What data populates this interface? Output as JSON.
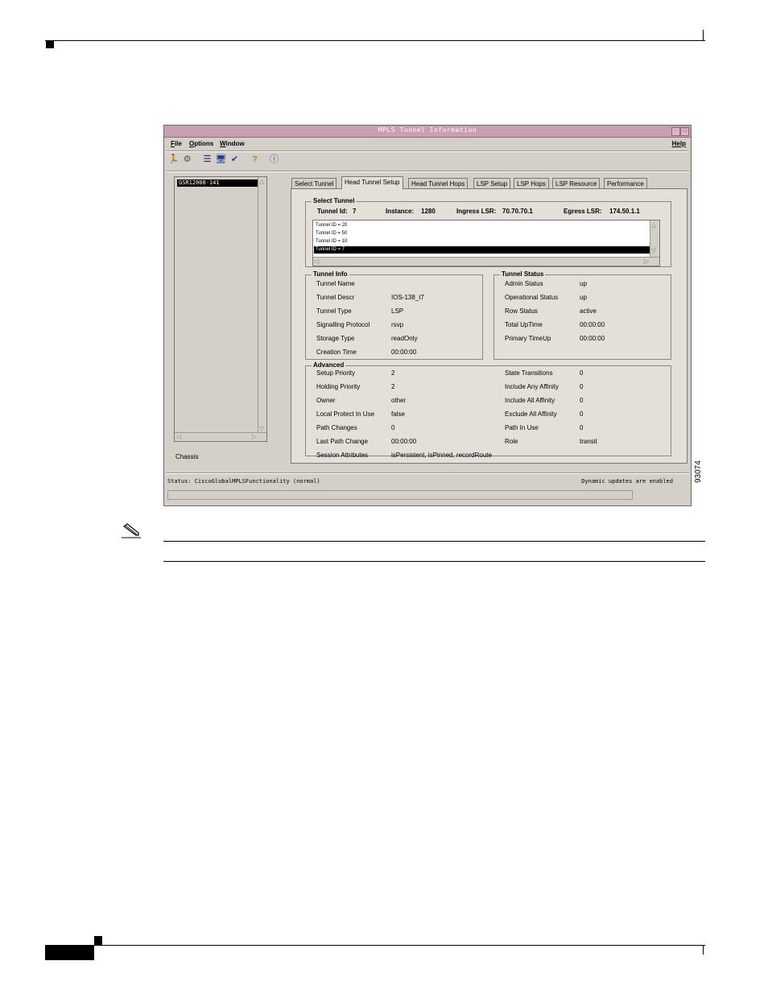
{
  "window": {
    "title": "MPLS Tunnel Information",
    "menus": [
      {
        "label": "File",
        "u": "F",
        "rest": "ile"
      },
      {
        "label": "Options",
        "u": "O",
        "rest": "ptions"
      },
      {
        "label": "Window",
        "u": "W",
        "rest": "indow"
      }
    ],
    "help_menu": "Help",
    "toolbar_icons": [
      "run-icon",
      "deploy-icon",
      "list-icon",
      "monitor-icon",
      "check-icon",
      "help-icon",
      "info-icon"
    ]
  },
  "tree": {
    "selected_node": "GSR12008-141",
    "chassis_label": "Chassis"
  },
  "tabs": [
    {
      "label": "Select Tunnel",
      "active": false
    },
    {
      "label": "Head Tunnel Setup",
      "active": true
    },
    {
      "label": "Head Tunnel Hops",
      "active": false
    },
    {
      "label": "LSP Setup",
      "active": false
    },
    {
      "label": "LSP Hops",
      "active": false
    },
    {
      "label": "LSP Resource",
      "active": false
    },
    {
      "label": "Performance",
      "active": false
    }
  ],
  "select_tunnel": {
    "legend": "Select Tunnel",
    "tunnel_id_label": "Tunnel Id:",
    "tunnel_id": "7",
    "instance_label": "Instance:",
    "instance": "1280",
    "ingress_label": "Ingress LSR:",
    "ingress": "70.70.70.1",
    "egress_label": "Egress LSR:",
    "egress": "174.50.1.1",
    "list": [
      "Tunnel ID = 20",
      "Tunnel ID = 50",
      "Tunnel ID = 10",
      "Tunnel ID = 7"
    ],
    "selected_index": 3
  },
  "tunnel_info": {
    "legend": "Tunnel Info",
    "rows": [
      {
        "label": "Tunnel Name",
        "value": ""
      },
      {
        "label": "Tunnel Descr",
        "value": "IOS-138_t7"
      },
      {
        "label": "Tunnel Type",
        "value": "LSP"
      },
      {
        "label": "Signalling Protocol",
        "value": "rsvp"
      },
      {
        "label": "Storage Type",
        "value": "readOnly"
      },
      {
        "label": "Creation Time",
        "value": "00:00:00"
      }
    ]
  },
  "tunnel_status": {
    "legend": "Tunnel Status",
    "rows": [
      {
        "label": "Admin Status",
        "value": "up"
      },
      {
        "label": "Operational Status",
        "value": "up"
      },
      {
        "label": "Row Status",
        "value": "active"
      },
      {
        "label": "Total UpTime",
        "value": "00:00:00"
      },
      {
        "label": "Primary TimeUp",
        "value": "00:00:00"
      }
    ]
  },
  "advanced": {
    "legend": "Advanced",
    "left": [
      {
        "label": "Setup Priority",
        "value": "2"
      },
      {
        "label": "Holding Priority",
        "value": "2"
      },
      {
        "label": "Owner",
        "value": "other"
      },
      {
        "label": "Local Protect In Use",
        "value": "false"
      },
      {
        "label": "Path Changes",
        "value": "0"
      },
      {
        "label": "Last Path Change",
        "value": "00:00:00"
      },
      {
        "label": "Session Attributes",
        "value": "isPersistent, isPinned, recordRoute"
      }
    ],
    "right": [
      {
        "label": "State Transitions",
        "value": "0"
      },
      {
        "label": "Include Any Affinity",
        "value": "0"
      },
      {
        "label": "Include All Affinity",
        "value": "0"
      },
      {
        "label": "Exclude All Affinity",
        "value": "0"
      },
      {
        "label": "Path In Use",
        "value": "0"
      },
      {
        "label": "Role",
        "value": "transit"
      }
    ]
  },
  "status": {
    "left": "Status: CiscoGlobalMPLSFunctionality (normal)",
    "right": "Dynamic updates are enabled"
  },
  "figure_id": "93074"
}
